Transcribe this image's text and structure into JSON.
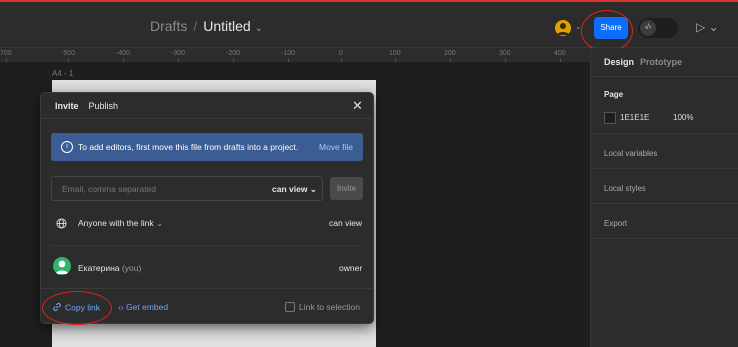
{
  "topbar": {
    "breadcrumb_root": "Drafts",
    "separator": "/",
    "file_title": "Untitled",
    "title_chevron": "⌄",
    "share_label": "Share",
    "code_icon_glyph": "‹/›",
    "play_glyph": "▷ ⌄"
  },
  "ruler": {
    "ticks": [
      "700",
      "-500",
      "-400",
      "-300",
      "-200",
      "-100",
      "0",
      "100",
      "200",
      "300",
      "400"
    ]
  },
  "canvas": {
    "frame_label": "A4 - 1",
    "frame_color": "#E1E1E1"
  },
  "right_panel": {
    "tab_design": "Design",
    "tab_prototype": "Prototype",
    "page_label": "Page",
    "page_color_hex": "1E1E1E",
    "page_opacity": "100%",
    "local_variables": "Local variables",
    "local_styles": "Local styles",
    "export": "Export"
  },
  "share_modal": {
    "tab_invite": "Invite",
    "tab_publish": "Publish",
    "close_glyph": "✕",
    "info_icon_glyph": "i",
    "info_text": "To add editors, first move this file from drafts into a project.",
    "info_link": "Move file",
    "email_placeholder": "Email, comma separated",
    "email_permission": "can view ⌄",
    "invite_button": "Invite",
    "anyone_label": "Anyone with the link",
    "anyone_chevron": "⌄",
    "anyone_permission": "can view",
    "user_name": "Екатерина",
    "user_you": "(you)",
    "user_role": "owner",
    "copy_link": "Copy link",
    "get_embed": "Get embed",
    "embed_icon_glyph": "‹›",
    "link_to_selection": "Link to selection"
  },
  "colors": {
    "accent": "#0D6EFD",
    "info_banner": "#3B5D93",
    "link": "#6EA8FF",
    "annotation": "#E0221F"
  }
}
